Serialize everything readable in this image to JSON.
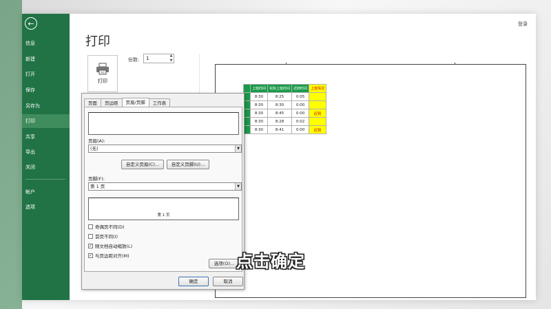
{
  "sidebar": {
    "back_icon": "back-arrow-icon",
    "items": [
      {
        "label": "信息"
      },
      {
        "label": "新建"
      },
      {
        "label": "打开"
      },
      {
        "label": "保存"
      },
      {
        "label": "另存为"
      },
      {
        "label": "打印",
        "active": true
      },
      {
        "label": "共享"
      },
      {
        "label": "导出"
      },
      {
        "label": "关闭"
      },
      {
        "label": "帐户"
      },
      {
        "label": "选项"
      }
    ],
    "color": "#217346"
  },
  "header": {
    "login": "登录"
  },
  "print_panel": {
    "title": "打印",
    "print_button_label": "打印",
    "copies_label": "份数:",
    "copies_value": "1"
  },
  "dialog": {
    "tabs": [
      "页面",
      "页边距",
      "页眉/页脚",
      "工作表"
    ],
    "active_tab": "页眉/页脚",
    "header_label": "页眉(A):",
    "header_value": "(无)",
    "custom_header_btn": "自定义页眉(C)...",
    "custom_footer_btn": "自定义页脚(U)...",
    "footer_label": "页脚(F):",
    "footer_value": "第 1 页",
    "footer_preview_text": "第 1 页",
    "checkboxes": [
      {
        "label": "奇偶页不同(D)",
        "checked": false
      },
      {
        "label": "首页不同(I)",
        "checked": false
      },
      {
        "label": "随文档自动缩放(L)",
        "checked": true
      },
      {
        "label": "与页边距对齐(M)",
        "checked": true
      }
    ],
    "options_btn": "选项(O)...",
    "ok_btn": "确定",
    "cancel_btn": "取消"
  },
  "preview": {
    "headers": [
      "上班时间",
      "实际上班时间",
      "迟到时间",
      "上班情况"
    ],
    "rows": [
      [
        "8:30",
        "8:25",
        "0:05",
        ""
      ],
      [
        "8:30",
        "8:30",
        "0:00",
        ""
      ],
      [
        "8:30",
        "8:45",
        "0:00",
        "迟到"
      ],
      [
        "8:30",
        "8:28",
        "0:02",
        ""
      ],
      [
        "8:30",
        "8:41",
        "0:00",
        "迟到"
      ]
    ]
  },
  "caption": "点击确定"
}
